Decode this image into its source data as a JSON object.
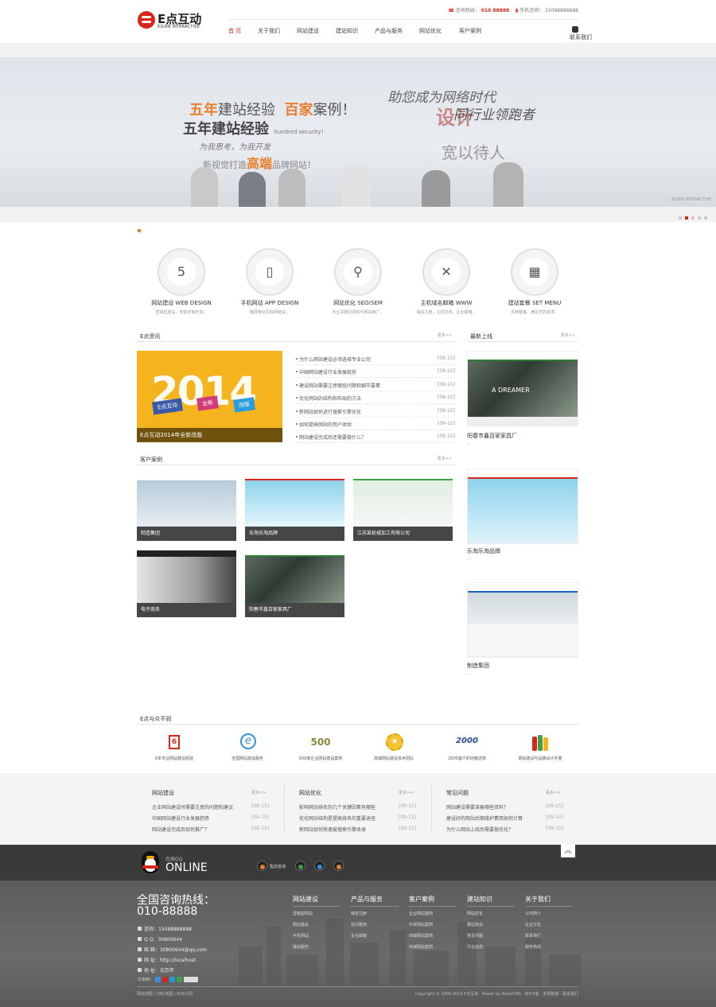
{
  "header": {
    "logo_cn": "E点互动",
    "logo_en": "EDIAN INTERACTIVE",
    "hotline_label": "咨询热线：",
    "hotline": "010 88888",
    "mobile_label": "手机咨询：",
    "mobile": "15088888888",
    "lang": "联系我们"
  },
  "nav": [
    "首 页",
    "关于我们",
    "网站建设",
    "建站知识",
    "产品与服务",
    "网站优化",
    "客户案例"
  ],
  "banner": {
    "left_line1_a": "五年",
    "left_line1_b": "建站经验",
    "left_line1_c": "百家",
    "left_line1_d": "案例！",
    "left_line2": "五年建站经验",
    "left_line2_en": "hundred security！",
    "left_line3": "为我思考，为我开发",
    "left_line4_a": "新视觉打造",
    "left_line4_b": "高端",
    "left_line4_c": "品牌网站！",
    "right_line1": "助您成为网络时代",
    "right_line2": "设计",
    "right_line3": "同行业领跑者",
    "right_line4": "宽以待人",
    "watermark": "EDIAN INTERACTIVE"
  },
  "services": [
    {
      "icon": "html5-icon",
      "glyph": "5",
      "title": "网站建设 WEB DESIGN",
      "desc": "营销型建站，按需定制开发。"
    },
    {
      "icon": "tablet-icon",
      "glyph": "▯",
      "title": "手机网站 APP DESIGN",
      "desc": "触屏移动互联网建设。"
    },
    {
      "icon": "search-icon",
      "glyph": "⚲",
      "title": "网站优化 SEO/SEM",
      "desc": "专业关键词排名与网站推广。"
    },
    {
      "icon": "tools-icon",
      "glyph": "✕",
      "title": "主机域名邮箱 WWW",
      "desc": "域名注册，主机空间，企业邮箱。"
    },
    {
      "icon": "grid-icon",
      "glyph": "▦",
      "title": "建站套餐 SET MENU",
      "desc": "多种套餐，满足您的需求。"
    }
  ],
  "news": {
    "title": "E点资讯",
    "more": "更多>>",
    "image_year": "2014",
    "image_tags": [
      "E点互动",
      "全新",
      "改版"
    ],
    "image_caption": "E点互动2014年全新改版",
    "items": [
      {
        "title": "为什么网站建设必须选择专业公司",
        "date": "[09-15]"
      },
      {
        "title": "中国网站建设行业发展现状",
        "date": "[09-15]"
      },
      {
        "title": "建设网站需要注意哪些问题和细节要素",
        "date": "[09-15]"
      },
      {
        "title": "优化网站的结构和布局的方法",
        "date": "[09-15]"
      },
      {
        "title": "新网站如何进行搜索引擎优化",
        "date": "[09-15]"
      },
      {
        "title": "如何提高网站的用户体验",
        "date": "[09-15]"
      },
      {
        "title": "网站建设完成后还需要做什么？",
        "date": "[09-15]"
      }
    ]
  },
  "latest": {
    "title": "最新上线",
    "more": "更多>>",
    "items": [
      {
        "name": "阳春市鑫百家家具厂",
        "sub": "..."
      },
      {
        "name": "乐淘乐淘品牌",
        "sub": "..."
      },
      {
        "name": "制造集团",
        "sub": "..."
      }
    ]
  },
  "cases": {
    "title": "客户案例",
    "more": "更多>>",
    "items": [
      "制造集团",
      "乐淘乐淘品牌",
      "江苏某机械加工有限公司",
      "电子商务",
      "阳春市鑫百家家具厂"
    ]
  },
  "why": {
    "title": "E点与众不同",
    "items": [
      {
        "label": "6年专业网站建设经验",
        "icon": "badge-6-icon",
        "glyph": "6"
      },
      {
        "label": "全国网站建设服务",
        "icon": "ie-icon",
        "glyph": "e"
      },
      {
        "label": "500家企业网站建设案例",
        "icon": "500-icon",
        "glyph": "500"
      },
      {
        "label": "高端网站建设技术团队",
        "icon": "medal-icon",
        "glyph": "★"
      },
      {
        "label": "2000客户的信赖选择",
        "icon": "2000-client-icon",
        "glyph": "2000"
      },
      {
        "label": "网站建设与品牌设计并重",
        "icon": "bottles-icon",
        "glyph": "♜"
      }
    ]
  },
  "faq": [
    {
      "title": "网站建设",
      "more": "更多>>",
      "items": [
        {
          "t": "企业网站建设时需要注意的问题和建议",
          "d": "[09-15]"
        },
        {
          "t": "中国网站建设行业发展趋势",
          "d": "[09-15]"
        },
        {
          "t": "网站建设完成后如何推广？",
          "d": "[09-15]"
        }
      ]
    },
    {
      "title": "网站优化",
      "more": "更多>>",
      "items": [
        {
          "t": "影响网站排名的几个关键因素有哪些",
          "d": "[09-15]"
        },
        {
          "t": "优化网站结构是提高排名的重要途径",
          "d": "[09-15]"
        },
        {
          "t": "新网站如何快速被搜索引擎收录",
          "d": "[09-15]"
        }
      ]
    },
    {
      "title": "常见问题",
      "more": "更多>>",
      "items": [
        {
          "t": "网站建设需要准备哪些资料？",
          "d": "[09-15]"
        },
        {
          "t": "建设好的网站后期维护费用如何计算",
          "d": "[09-15]"
        },
        {
          "t": "为什么网站上线后需要做优化？",
          "d": "[09-15]"
        }
      ]
    }
  ],
  "online": {
    "label": "在线QQ",
    "big": "ONLINE",
    "service_label": "售前咨询",
    "totop": "︽"
  },
  "footer": {
    "hot_label": "全国咨询热线：",
    "hot_number": "010-88888",
    "contacts": [
      "咨询：15088888888",
      "Q Q：30800644",
      "邮 箱：30800644@qq.com",
      "网 址：http://localhost",
      "地 址：北京市"
    ],
    "share": "分享到：",
    "cols": [
      {
        "title": "网站建设",
        "items": [
          "营销型网站",
          "网站建设",
          "手机网站",
          "建站服务"
        ]
      },
      {
        "title": "产品与服务",
        "items": [
          "域名注册",
          "空间租用",
          "企业邮箱"
        ]
      },
      {
        "title": "客户案例",
        "items": [
          "企业网站案例",
          "外贸网站案例",
          "商城网站案例",
          "商城网站案例"
        ]
      },
      {
        "title": "建站知识",
        "items": [
          "网站优化",
          "建站知识",
          "常见问题",
          "行业动态"
        ]
      },
      {
        "title": "关于我们",
        "items": [
          "公司简介",
          "企业文化",
          "联系我们",
          "服务热线"
        ]
      }
    ],
    "copy_left": "网站地图 | XML地图 | RSS订阅",
    "copy_right": "Copyright © 2009-2014 E点互动 · Power by DedeCMS · 京ICP备 · 友情链接 · 联系我们"
  },
  "colors": {
    "brand_red": "#d9261c",
    "accent_orange": "#e97e2e",
    "banner_bg": "#e5e9ed",
    "dark_strip": "#3a3a3a"
  }
}
